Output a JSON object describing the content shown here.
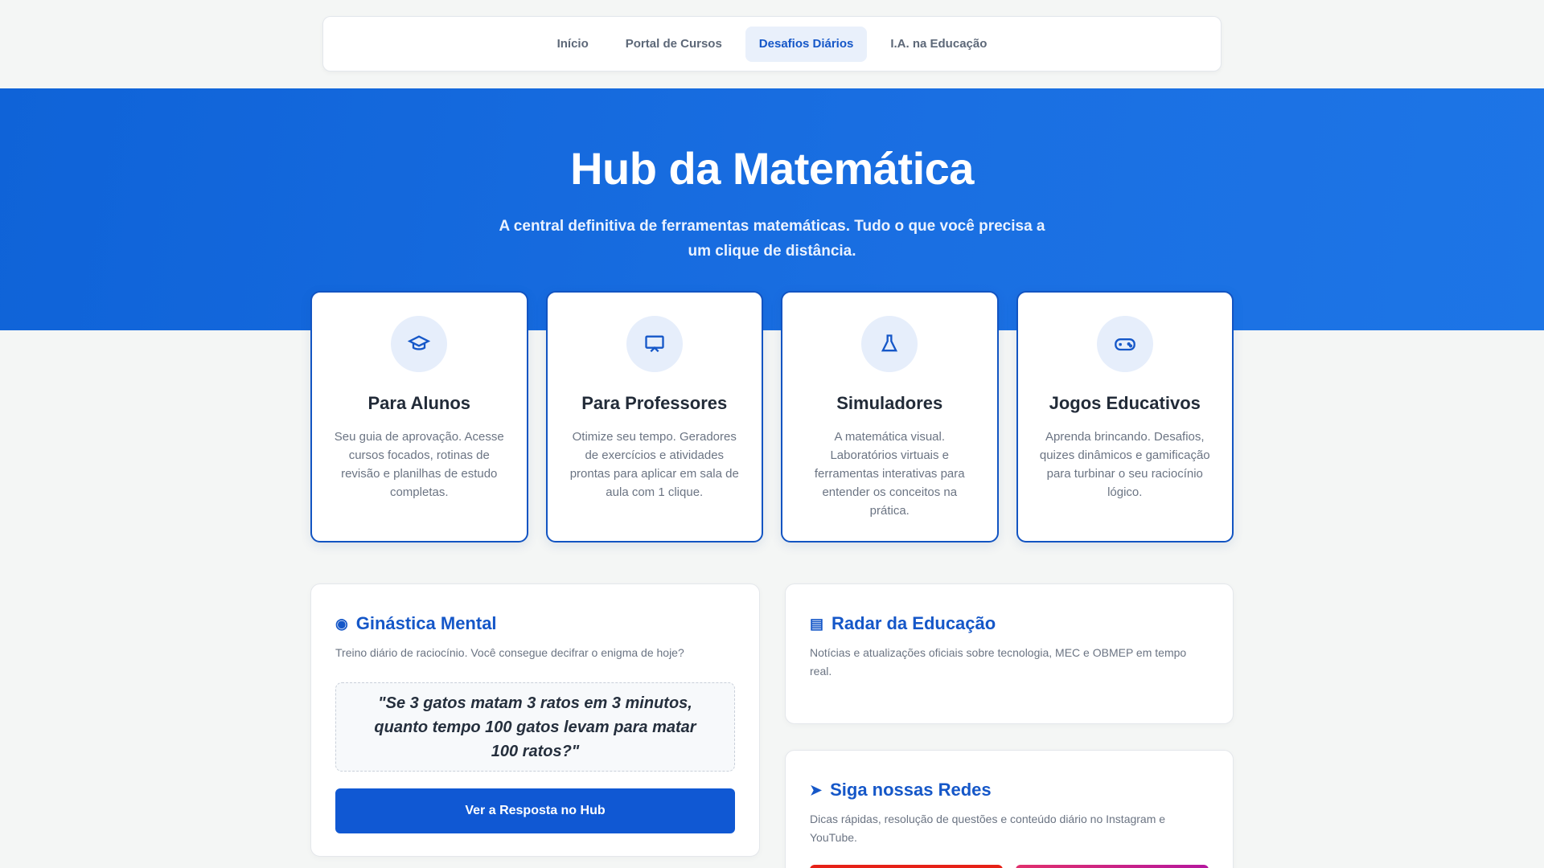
{
  "nav": {
    "links": [
      {
        "label": "Início"
      },
      {
        "label": "Portal de Cursos"
      },
      {
        "label": "Desafios Diários",
        "active": true
      },
      {
        "label": "I.A. na Educação"
      }
    ]
  },
  "hero": {
    "title": "Hub da Matemática",
    "subtitle": "A central definitiva de ferramentas matemáticas. Tudo o que você precisa a um clique de distância."
  },
  "cards": [
    {
      "icon": "graduation-cap-icon",
      "title": "Para Alunos",
      "text": "Seu guia de aprovação. Acesse cursos focados, rotinas de revisão e planilhas de estudo completas."
    },
    {
      "icon": "chalkboard-teacher-icon",
      "title": "Para Professores",
      "text": "Otimize seu tempo. Geradores de exercícios e atividades prontas para aplicar em sala de aula com 1 clique."
    },
    {
      "icon": "flask-icon",
      "title": "Simuladores",
      "text": "A matemática visual. Laboratórios virtuais e ferramentas interativas para entender os conceitos na prática."
    },
    {
      "icon": "gamepad-icon",
      "title": "Jogos Educativos",
      "text": "Aprenda brincando. Desafios, quizes dinâmicos e gamificação para turbinar o seu raciocínio lógico."
    }
  ],
  "mental": {
    "icon": "brain-icon",
    "title": "Ginástica Mental",
    "desc": "Treino diário de raciocínio. Você consegue decifrar o enigma de hoje?",
    "quote": "\"Se 3 gatos matam 3 ratos em 3 minutos, quanto tempo 100 gatos levam para matar 100 ratos?\"",
    "button": "Ver a Resposta no Hub"
  },
  "radar": {
    "icon": "newspaper-icon",
    "title": "Radar da Educação",
    "desc": "Notícias e atualizações oficiais sobre tecnologia, MEC e OBMEP em tempo real."
  },
  "redes": {
    "icon": "share-icon",
    "title": "Siga nossas Redes",
    "desc": "Dicas rápidas, resolução de questões e conteúdo diário no Instagram e YouTube."
  },
  "colors": {
    "primary": "#1557c8",
    "hero_bg": "#1568dd",
    "youtube": "#e62117",
    "instagram": "#c13584"
  }
}
